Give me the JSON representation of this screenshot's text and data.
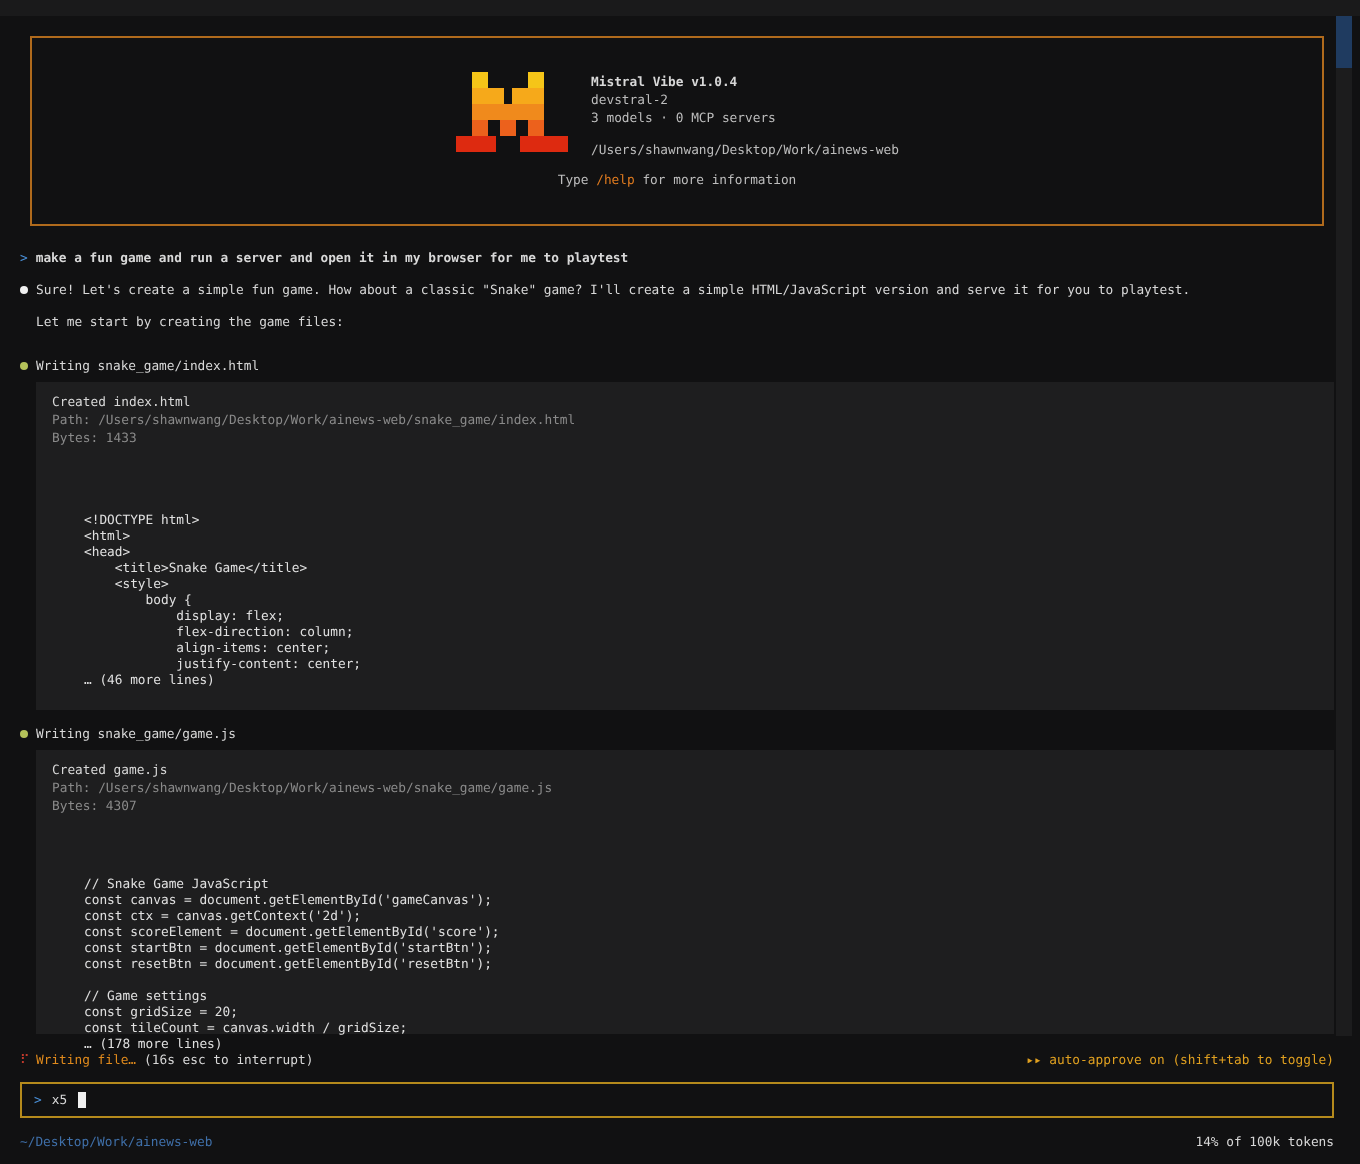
{
  "banner": {
    "title": "Mistral Vibe v1.0.4",
    "model": "devstral-2",
    "stats": "3 models · 0 MCP servers",
    "cwd": "/Users/shawnwang/Desktop/Work/ainews-web",
    "hint": {
      "before": "Type",
      "command": "/help",
      "after": "for more information"
    }
  },
  "conversation": [
    {
      "kind": "user",
      "marker": ">",
      "text": "make a fun game and run a server and open it in my browser for me to playtest"
    },
    {
      "kind": "assistant",
      "lines": [
        "Sure! Let's create a simple fun game. How about a classic \"Snake\" game? I'll create a simple HTML/JavaScript version and serve it for you to playtest.",
        "Let me start by creating the game files:"
      ]
    },
    {
      "kind": "tool",
      "title": "Writing snake_game/index.html",
      "created": "Created index.html",
      "path": "Path: /Users/shawnwang/Desktop/Work/ainews-web/snake_game/index.html",
      "bytes": "Bytes: 1433",
      "code": [
        [
          "<!DOCTYPE html>",
          "<html>",
          "<head>",
          "    <title>Snake Game</title>",
          "    <style>",
          "        body {",
          "            display: flex;",
          "            flex-direction: column;",
          "            align-items: center;",
          "            justify-content: center;"
        ]
      ],
      "more": "… (46 more lines)"
    },
    {
      "kind": "tool",
      "title": "Writing snake_game/game.js",
      "created": "Created game.js",
      "path": "Path: /Users/shawnwang/Desktop/Work/ainews-web/snake_game/game.js",
      "bytes": "Bytes: 4307",
      "code": [
        [
          "// Snake Game JavaScript",
          "const canvas = document.getElementById('gameCanvas');",
          "const ctx = canvas.getContext('2d');",
          "const scoreElement = document.getElementById('score');",
          "const startBtn = document.getElementById('startBtn');",
          "const resetBtn = document.getElementById('resetBtn');"
        ],
        [
          "// Game settings",
          "const gridSize = 20;",
          "const tileCount = canvas.width / gridSize;"
        ]
      ],
      "more": "… (178 more lines)"
    }
  ],
  "status": {
    "spinner": "⠏",
    "activity": "Writing file…",
    "detail": "(16s esc to interrupt)",
    "auto_approve": "▸▸ auto-approve on (shift+tab to toggle)"
  },
  "input": {
    "prompt": ">",
    "value": "x5"
  },
  "footer": {
    "cwd": "~/Desktop/Work/ainews-web",
    "tokens": "14% of 100k tokens"
  }
}
